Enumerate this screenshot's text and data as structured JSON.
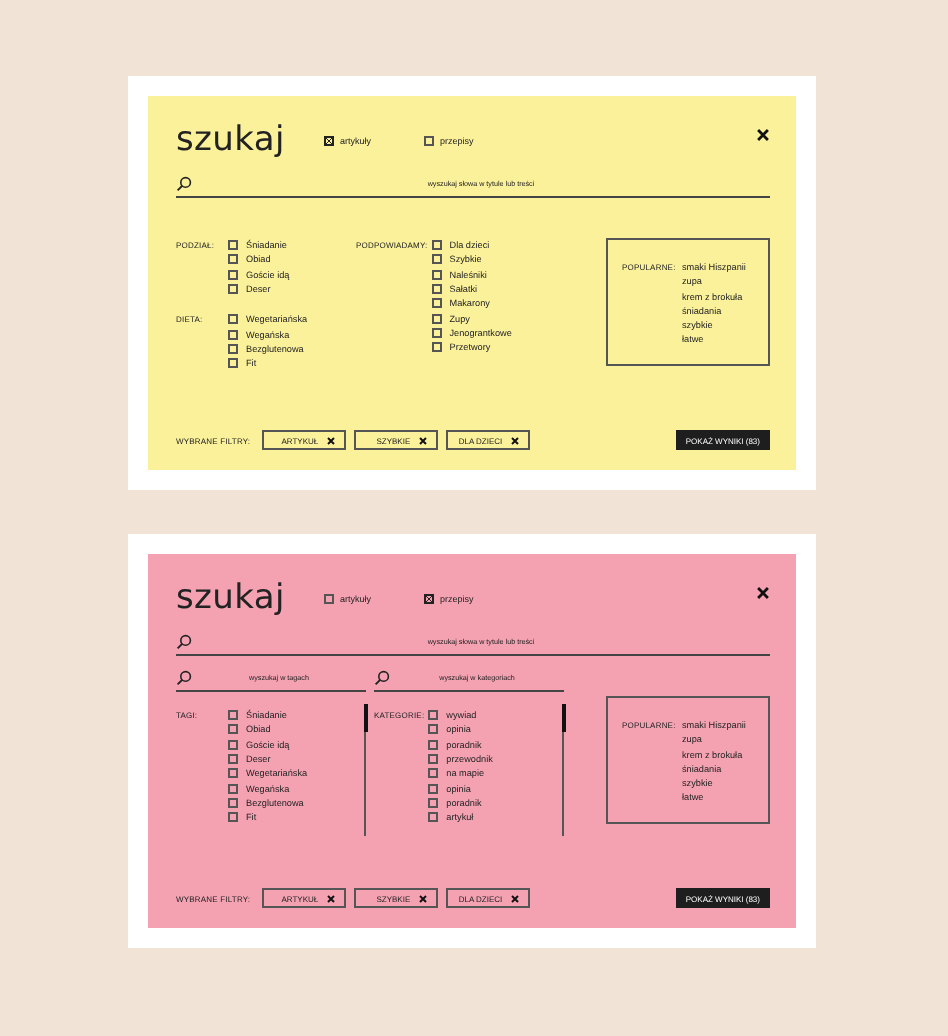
{
  "screens": [
    {
      "color": "#fbf19a",
      "title": "szukaj",
      "tabs": [
        {
          "label": "artykuły",
          "selected": true
        },
        {
          "label": "przepisy",
          "selected": false
        }
      ],
      "search": {
        "placeholder": "wyszukaj słowa w tytule lub treści"
      },
      "columns": [
        {
          "groups": [
            {
              "label": "PODZIAŁ:",
              "options": [
                {
                  "label": "Śniadanie",
                  "checked": false
                },
                {
                  "label": "Obiad",
                  "checked": false
                },
                {
                  "label": "Goście idą",
                  "checked": false
                },
                {
                  "label": "Deser",
                  "checked": false
                }
              ]
            },
            {
              "label": "DIETA:",
              "options": [
                {
                  "label": "Wegetariańska",
                  "checked": false
                },
                {
                  "label": "Wegańska",
                  "checked": false
                },
                {
                  "label": "Bezglutenowa",
                  "checked": false
                },
                {
                  "label": "Fit",
                  "checked": false
                }
              ]
            }
          ]
        },
        {
          "groups": [
            {
              "label": "PODPOWIADAMY:",
              "options": [
                {
                  "label": "Dla dzieci",
                  "checked": false
                },
                {
                  "label": "Szybkie",
                  "checked": false
                },
                {
                  "label": "Naleśniki",
                  "checked": false
                },
                {
                  "label": "Sałatki",
                  "checked": false
                },
                {
                  "label": "Makarony",
                  "checked": false
                },
                {
                  "label": "Zupy",
                  "checked": false
                },
                {
                  "label": "Jenograntkowe",
                  "checked": false
                },
                {
                  "label": "Przetwory",
                  "checked": false
                }
              ]
            }
          ]
        }
      ],
      "popular": {
        "label": "POPULARNE:",
        "items": [
          "smaki Hiszpanii",
          "zupa",
          "krem z brokuła",
          "śniadania",
          "szybkie",
          "łatwe"
        ]
      },
      "chosen": {
        "label": "WYBRANE FILTRY:",
        "chips": [
          "ARTYKUŁ",
          "SZYBKIE",
          "DLA DZIECI"
        ]
      },
      "button": "POKAŻ WYNIKI (83)"
    },
    {
      "color": "#f4a2b2",
      "title": "szukaj",
      "tabs": [
        {
          "label": "artykuły",
          "selected": false
        },
        {
          "label": "przepisy",
          "selected": true
        }
      ],
      "search": {
        "placeholder": "wyszukaj słowa w tytule lub treści"
      },
      "columns": [
        {
          "search": "wyszukaj w tagach",
          "scrollable": true,
          "groups": [
            {
              "label": "TAGI:",
              "options": [
                {
                  "label": "Śniadanie",
                  "checked": false
                },
                {
                  "label": "Obiad",
                  "checked": false
                },
                {
                  "label": "Goście idą",
                  "checked": false
                },
                {
                  "label": "Deser",
                  "checked": false
                },
                {
                  "label": "Wegetariańska",
                  "checked": false
                },
                {
                  "label": "Wegańska",
                  "checked": false
                },
                {
                  "label": "Bezglutenowa",
                  "checked": false
                },
                {
                  "label": "Fit",
                  "checked": false
                }
              ]
            }
          ]
        },
        {
          "search": "wyszukaj w kategoriach",
          "scrollable": true,
          "groups": [
            {
              "label": "KATEGORIE:",
              "options": [
                {
                  "label": "wywiad",
                  "checked": false
                },
                {
                  "label": "opinia",
                  "checked": false
                },
                {
                  "label": "poradnik",
                  "checked": false
                },
                {
                  "label": "przewodnik",
                  "checked": false
                },
                {
                  "label": "na mapie",
                  "checked": false
                },
                {
                  "label": "opinia",
                  "checked": false
                },
                {
                  "label": "poradnik",
                  "checked": false
                },
                {
                  "label": "artykuł",
                  "checked": false
                }
              ]
            }
          ]
        }
      ],
      "popular": {
        "label": "POPULARNE:",
        "items": [
          "smaki Hiszpanii",
          "zupa",
          "krem z brokuła",
          "śniadania",
          "szybkie",
          "łatwe"
        ]
      },
      "chosen": {
        "label": "WYBRANE FILTRY:",
        "chips": [
          "ARTYKUŁ",
          "SZYBKIE",
          "DLA DZIECI"
        ]
      },
      "button": "POKAŻ WYNIKI (83)"
    }
  ]
}
